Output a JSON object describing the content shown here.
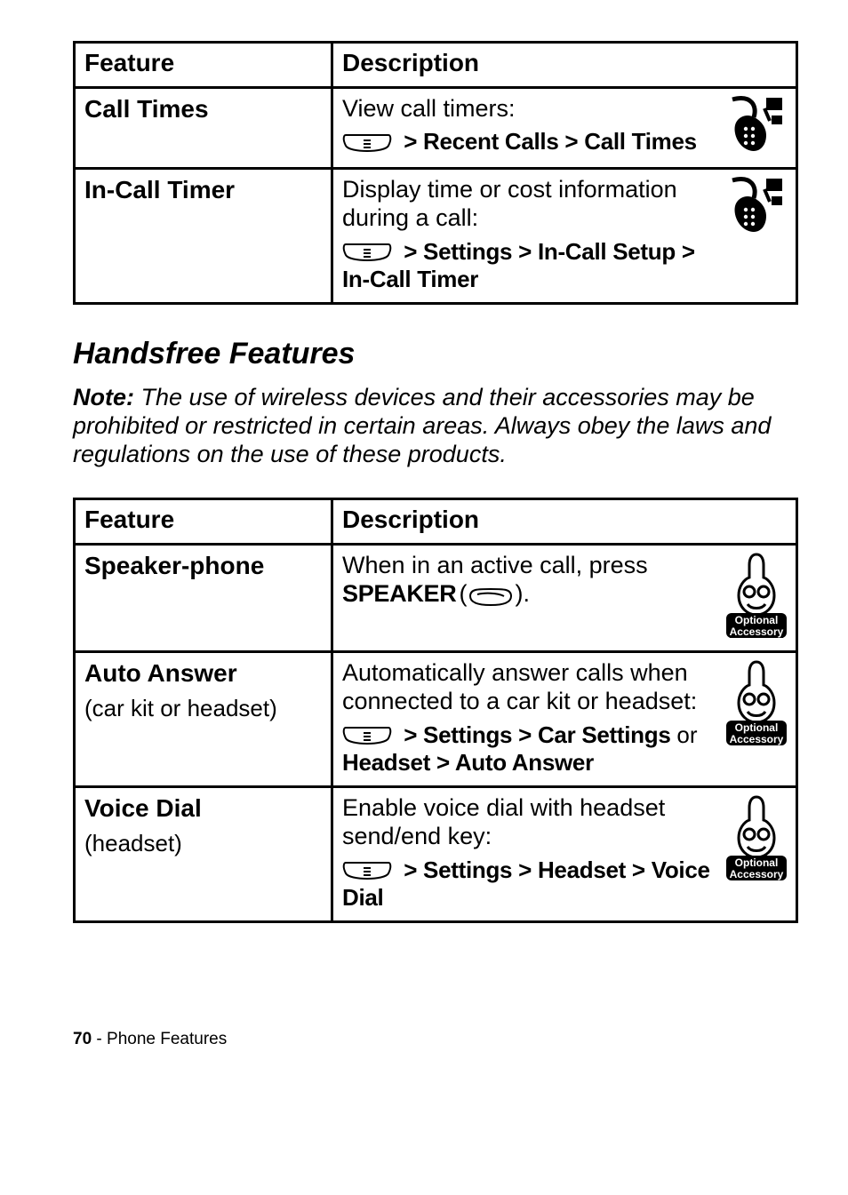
{
  "table1": {
    "headers": {
      "feature": "Feature",
      "description": "Description"
    },
    "rows": [
      {
        "name": "Call Times",
        "desc": "View call timers:",
        "path": " > Recent Calls > Call Times",
        "icon": "network"
      },
      {
        "name": "In-Call Timer",
        "desc": "Display time or cost information during a call:",
        "path": " > Settings > In-Call Setup > In-Call Timer",
        "icon": "network"
      }
    ]
  },
  "section_handsfree": {
    "title": "Handsfree Features",
    "note_label": "Note:",
    "note_text": " The use of wireless devices and their accessories may be prohibited or restricted in certain areas. Always obey the laws and regulations on the use of these products."
  },
  "table2": {
    "headers": {
      "feature": "Feature",
      "description": "Description"
    },
    "rows": [
      {
        "name": "Speaker-phone",
        "sub": "",
        "desc_pre": "When in an active call, press ",
        "key_label": "SPEAKER",
        "desc_post": ".",
        "path": "",
        "icon": "optional"
      },
      {
        "name": "Auto Answer",
        "sub": "(car kit or headset)",
        "desc": "Automatically answer calls when connected to a car kit or headset:",
        "path_pre": " > Settings > Car Settings ",
        "path_or": "or",
        "path_line2": "Headset > Auto Answer",
        "icon": "optional"
      },
      {
        "name": "Voice Dial",
        "sub": "(headset)",
        "desc": "Enable voice dial with headset send/end key:",
        "path": " > Settings > Headset > Voice Dial",
        "icon": "optional"
      }
    ]
  },
  "footer": {
    "page": "70",
    "sep": " - ",
    "section": "Phone Features"
  }
}
